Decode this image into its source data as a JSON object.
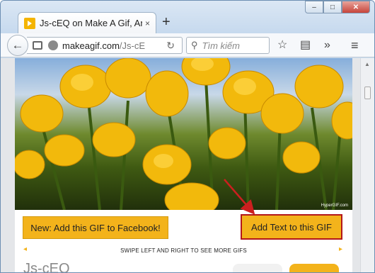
{
  "browser": {
    "tab_title": "Js-cEQ on Make A Gif, Ani...",
    "tab_close_glyph": "×",
    "new_tab_glyph": "+",
    "window_buttons": {
      "minimize": "–",
      "maximize": "□",
      "close": "✕"
    },
    "url_domain": "makeagif.com",
    "url_path": "/Js-cE",
    "search_placeholder": "Tìm kiếm",
    "icons": [
      "back-arrow-icon",
      "reader-icon",
      "globe-icon",
      "reload-icon",
      "search-icon",
      "bookmark-star-icon",
      "clipboard-icon",
      "overflow-chevrons-icon",
      "hamburger-menu-icon"
    ]
  },
  "page": {
    "image_watermark": "HyperGIF.com",
    "fb_button_label": "New: Add this GIF to Facebook!",
    "add_text_button_label": "Add Text to this GIF",
    "swipe_hint": "SWIPE LEFT AND RIGHT TO SEE MORE GIFS",
    "bottom_title_partial": "Js-cEQ"
  },
  "colors": {
    "accent": "#f3b31b",
    "highlight_border": "#b3171a",
    "annotation_arrow": "#cc1f1f"
  }
}
